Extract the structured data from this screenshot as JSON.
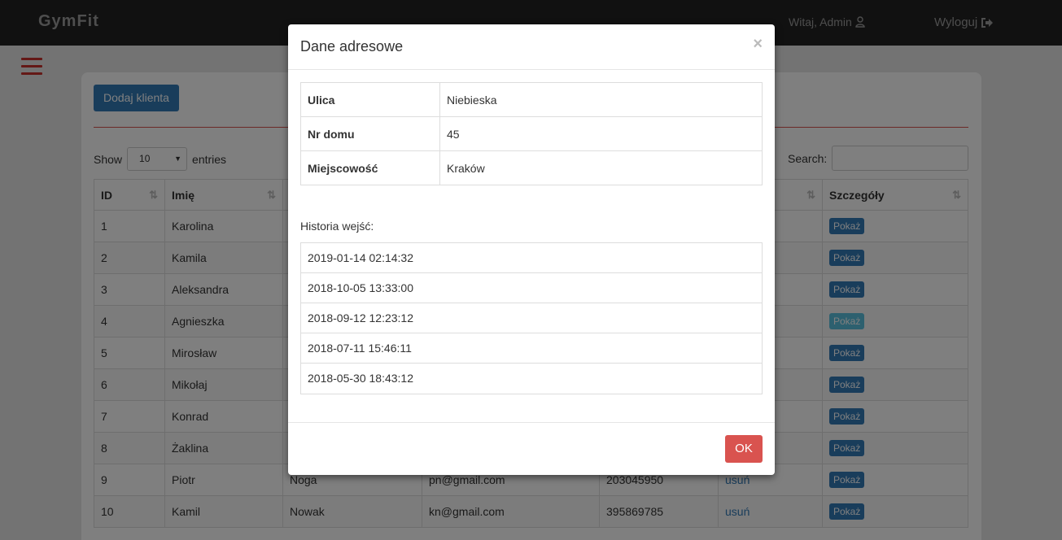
{
  "navbar": {
    "brand": "GymFit",
    "greeting": "Witaj, Admin",
    "logout": "Wyloguj"
  },
  "panel": {
    "add_button": "Dodaj klienta",
    "show_label": "Show",
    "entries_select": "10",
    "entries_label": "entries",
    "search_label": "Search:"
  },
  "table": {
    "headers": [
      "ID",
      "Imię",
      "",
      "",
      "",
      "",
      "Szczegóły"
    ],
    "rows": [
      {
        "id": "1",
        "name": "Karolina",
        "surname": "",
        "email": "",
        "phone": "",
        "action": "",
        "details": "Pokaż"
      },
      {
        "id": "2",
        "name": "Kamila",
        "surname": "",
        "email": "",
        "phone": "",
        "action": "",
        "details": "Pokaż"
      },
      {
        "id": "3",
        "name": "Aleksandra",
        "surname": "",
        "email": "",
        "phone": "",
        "action": "",
        "details": "Pokaż"
      },
      {
        "id": "4",
        "name": "Agnieszka",
        "surname": "",
        "email": "",
        "phone": "",
        "action": "",
        "details": "Pokaż"
      },
      {
        "id": "5",
        "name": "Mirosław",
        "surname": "",
        "email": "",
        "phone": "",
        "action": "",
        "details": "Pokaż"
      },
      {
        "id": "6",
        "name": "Mikołaj",
        "surname": "",
        "email": "",
        "phone": "",
        "action": "",
        "details": "Pokaż"
      },
      {
        "id": "7",
        "name": "Konrad",
        "surname": "",
        "email": "",
        "phone": "",
        "action": "",
        "details": "Pokaż"
      },
      {
        "id": "8",
        "name": "Żaklina",
        "surname": "",
        "email": "",
        "phone": "",
        "action": "",
        "details": "Pokaż"
      },
      {
        "id": "9",
        "name": "Piotr",
        "surname": "Noga",
        "email": "pn@gmail.com",
        "phone": "203045950",
        "action": "usuń",
        "details": "Pokaż"
      },
      {
        "id": "10",
        "name": "Kamil",
        "surname": "Nowak",
        "email": "kn@gmail.com",
        "phone": "395869785",
        "action": "usuń",
        "details": "Pokaż"
      }
    ]
  },
  "modal": {
    "title": "Dane adresowe",
    "close": "×",
    "address": [
      {
        "key": "Ulica",
        "value": "Niebieska"
      },
      {
        "key": "Nr domu",
        "value": "45"
      },
      {
        "key": "Miejscowość",
        "value": "Kraków"
      }
    ],
    "history_label": "Historia wejść:",
    "history": [
      "2019-01-14 02:14:32",
      "2018-10-05 13:33:00",
      "2018-09-12 12:23:12",
      "2018-07-11 15:46:11",
      "2018-05-30 18:43:12"
    ],
    "ok_button": "OK"
  },
  "colors": {
    "navbar": "#222222",
    "primary": "#337ab7",
    "danger": "#d9534f"
  }
}
